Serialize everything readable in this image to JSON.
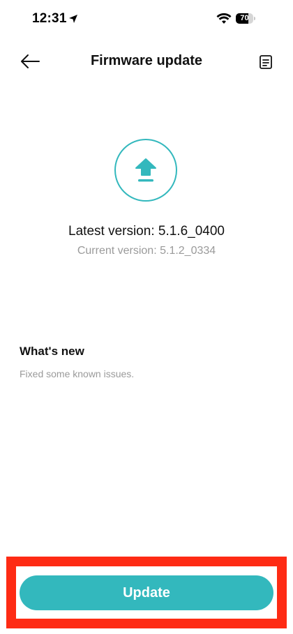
{
  "status_bar": {
    "time": "12:31",
    "battery_level": "70",
    "icons": [
      "location-arrow-icon",
      "wifi-icon",
      "battery-icon"
    ]
  },
  "header": {
    "title": "Firmware update",
    "back_icon": "arrow-left-icon",
    "notes_icon": "document-icon"
  },
  "firmware": {
    "icon": "upload-icon",
    "latest_version": "Latest version: 5.1.6_0400",
    "current_version": "Current version: 5.1.2_0334"
  },
  "whats_new": {
    "title": "What's new",
    "body": "Fixed some known issues."
  },
  "actions": {
    "update_label": "Update"
  },
  "colors": {
    "accent": "#33b8bd",
    "highlight_frame": "#fe2b14",
    "secondary_text": "#9a9a9a"
  }
}
